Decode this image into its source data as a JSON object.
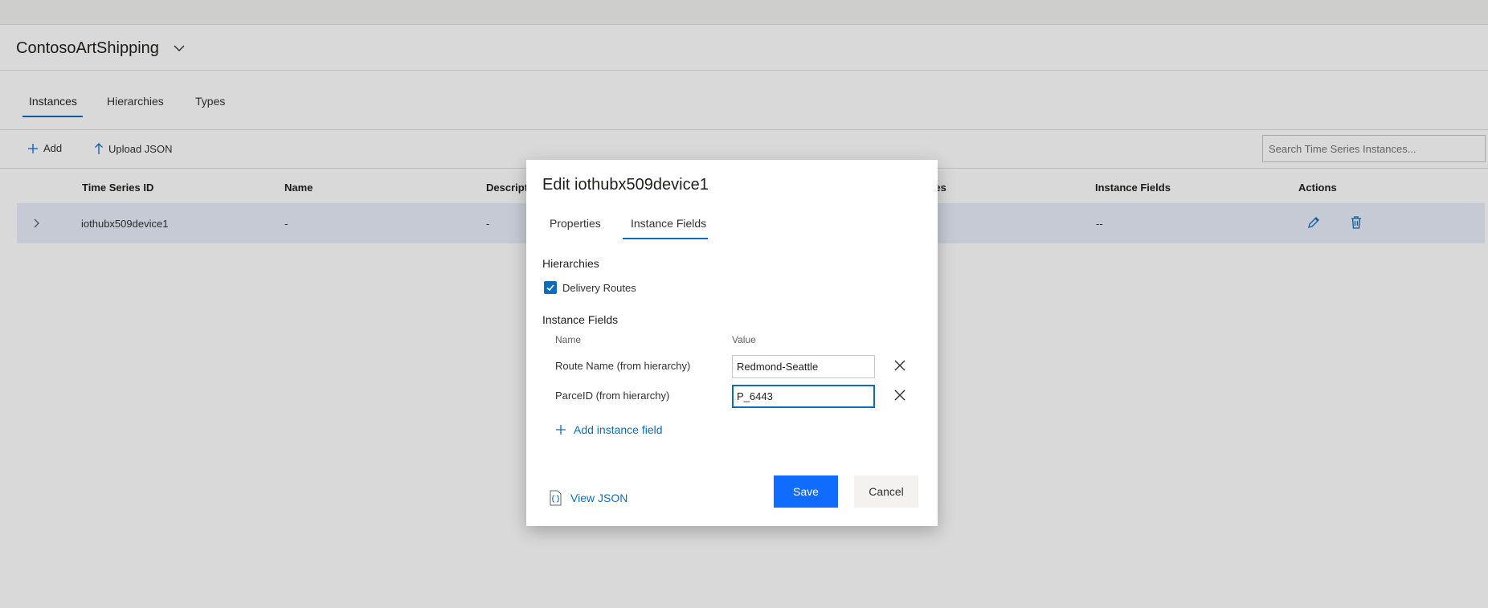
{
  "environment": {
    "name": "ContosoArtShipping"
  },
  "tabs": [
    {
      "label": "Instances"
    },
    {
      "label": "Hierarchies"
    },
    {
      "label": "Types"
    }
  ],
  "toolbar": {
    "add_label": "Add",
    "upload_label": "Upload JSON",
    "search_placeholder": "Search Time Series Instances..."
  },
  "grid": {
    "columns": [
      "Time Series ID",
      "Name",
      "Description",
      "Hierarchies",
      "Instance Fields",
      "Actions"
    ],
    "rows": [
      {
        "id": "iothubx509device1",
        "name": "-",
        "description": "-",
        "instance_fields": "--"
      }
    ]
  },
  "dialog": {
    "title": "Edit iothubx509device1",
    "tabs": [
      {
        "label": "Properties"
      },
      {
        "label": "Instance Fields"
      }
    ],
    "hierarchies_label": "Hierarchies",
    "hierarchy_item": "Delivery Routes",
    "instance_fields_label": "Instance Fields",
    "col_name": "Name",
    "col_value": "Value",
    "fields": [
      {
        "name": "Route Name (from hierarchy)",
        "value": "Redmond-Seattle"
      },
      {
        "name": "ParceID (from hierarchy)",
        "value": "P_6443"
      }
    ],
    "add_field_label": "Add instance field",
    "view_json_label": "View JSON",
    "save_label": "Save",
    "cancel_label": "Cancel"
  },
  "colors": {
    "accent": "#0f6cbd",
    "primary_button": "#0f6cff",
    "selected_row": "#e8eef9"
  }
}
